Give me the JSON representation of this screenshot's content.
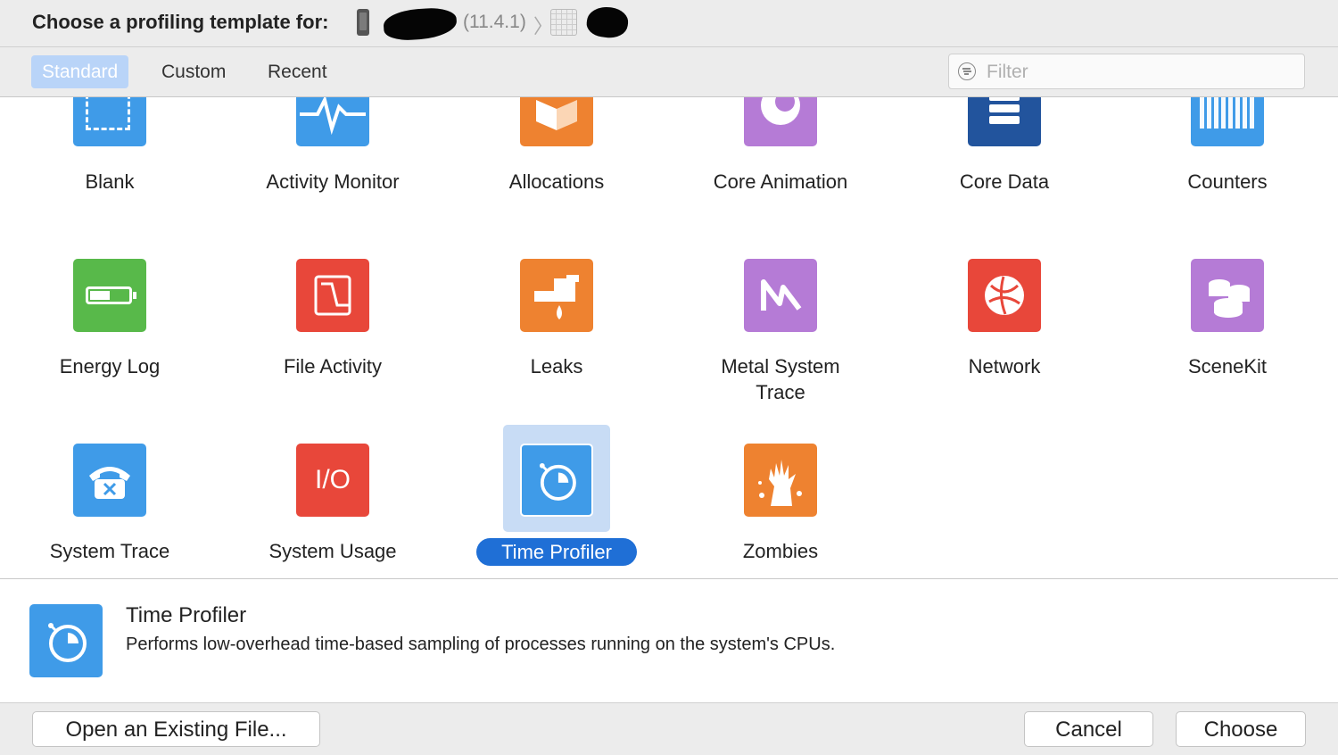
{
  "header": {
    "title": "Choose a profiling template for:",
    "version": "(11.4.1)",
    "separator": "〉"
  },
  "tabs": [
    {
      "label": "Standard",
      "active": true
    },
    {
      "label": "Custom",
      "active": false
    },
    {
      "label": "Recent",
      "active": false
    }
  ],
  "filter": {
    "placeholder": "Filter",
    "value": ""
  },
  "templates": [
    {
      "label": "Blank",
      "color": "#3f9be8",
      "icon": "blank-icon"
    },
    {
      "label": "Activity Monitor",
      "color": "#3f9be8",
      "icon": "activity-monitor-icon"
    },
    {
      "label": "Allocations",
      "color": "#ee8230",
      "icon": "allocations-icon"
    },
    {
      "label": "Core Animation",
      "color": "#b57bd6",
      "icon": "core-animation-icon"
    },
    {
      "label": "Core Data",
      "color": "#22549d",
      "icon": "core-data-icon"
    },
    {
      "label": "Counters",
      "color": "#3f9be8",
      "icon": "counters-icon"
    },
    {
      "label": "Energy Log",
      "color": "#58b94a",
      "icon": "battery-icon"
    },
    {
      "label": "File Activity",
      "color": "#e8473a",
      "icon": "file-activity-icon"
    },
    {
      "label": "Leaks",
      "color": "#ee8230",
      "icon": "leaks-icon"
    },
    {
      "label": "Metal System\nTrace",
      "color": "#b57bd6",
      "icon": "metal-icon"
    },
    {
      "label": "Network",
      "color": "#e8473a",
      "icon": "network-icon"
    },
    {
      "label": "SceneKit",
      "color": "#b57bd6",
      "icon": "scenekit-icon"
    },
    {
      "label": "System Trace",
      "color": "#3f9be8",
      "icon": "telephone-icon"
    },
    {
      "label": "System Usage",
      "color": "#e8473a",
      "icon": "io-icon"
    },
    {
      "label": "Time Profiler",
      "color": "#3f9be8",
      "icon": "stopwatch-icon",
      "selected": true
    },
    {
      "label": "Zombies",
      "color": "#ee8230",
      "icon": "zombie-hand-icon"
    }
  ],
  "io_text": "I/O",
  "details": {
    "title": "Time Profiler",
    "description": "Performs low-overhead time-based sampling of processes running on the system's CPUs."
  },
  "footer": {
    "open_label": "Open an Existing File...",
    "cancel_label": "Cancel",
    "choose_label": "Choose"
  }
}
